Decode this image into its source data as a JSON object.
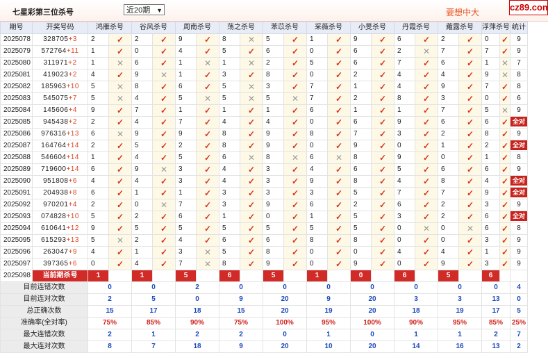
{
  "header": {
    "title": "七星彩第三位杀号",
    "range_selected": "近20期",
    "promo": "要想中大",
    "badge": "cz89.com"
  },
  "columns": [
    "期号",
    "开奖号码",
    "鸿雁杀号",
    "谷风杀号",
    "周南杀号",
    "荡之杀号",
    "苯苡杀号",
    "采薇杀号",
    "小旻杀号",
    "丹霞杀号",
    "蕹露杀号",
    "浮萍杀号",
    "统计"
  ],
  "rows": [
    {
      "period": "2025078",
      "draw": "328705",
      "diff": "+3",
      "kills": [
        "2",
        "2",
        "9",
        "8",
        "5",
        "1",
        "9",
        "6",
        "2",
        "0"
      ],
      "marks": [
        "v",
        "v",
        "v",
        "x",
        "v",
        "v",
        "v",
        "v",
        "v",
        "v"
      ],
      "count": "9"
    },
    {
      "period": "2025079",
      "draw": "572764",
      "diff": "+11",
      "kills": [
        "1",
        "0",
        "4",
        "5",
        "6",
        "0",
        "6",
        "2",
        "7",
        "7"
      ],
      "marks": [
        "v",
        "v",
        "v",
        "v",
        "v",
        "v",
        "v",
        "x",
        "v",
        "v"
      ],
      "count": "9"
    },
    {
      "period": "2025080",
      "draw": "311971",
      "diff": "+2",
      "kills": [
        "1",
        "6",
        "1",
        "1",
        "2",
        "5",
        "6",
        "7",
        "6",
        "1"
      ],
      "marks": [
        "x",
        "v",
        "x",
        "x",
        "v",
        "v",
        "v",
        "v",
        "v",
        "x"
      ],
      "count": "7"
    },
    {
      "period": "2025081",
      "draw": "419023",
      "diff": "+2",
      "kills": [
        "4",
        "9",
        "1",
        "3",
        "8",
        "0",
        "2",
        "4",
        "4",
        "9"
      ],
      "marks": [
        "v",
        "x",
        "v",
        "v",
        "v",
        "v",
        "v",
        "v",
        "v",
        "x"
      ],
      "count": "8"
    },
    {
      "period": "2025082",
      "draw": "185963",
      "diff": "+10",
      "kills": [
        "5",
        "8",
        "6",
        "5",
        "3",
        "7",
        "1",
        "4",
        "9",
        "7"
      ],
      "marks": [
        "x",
        "v",
        "v",
        "x",
        "v",
        "v",
        "v",
        "v",
        "v",
        "v"
      ],
      "count": "8"
    },
    {
      "period": "2025083",
      "draw": "545075",
      "diff": "+7",
      "kills": [
        "5",
        "4",
        "5",
        "5",
        "5",
        "7",
        "2",
        "8",
        "3",
        "0"
      ],
      "marks": [
        "x",
        "v",
        "x",
        "x",
        "x",
        "v",
        "v",
        "v",
        "v",
        "v"
      ],
      "count": "6"
    },
    {
      "period": "2025084",
      "draw": "145606",
      "diff": "+4",
      "kills": [
        "9",
        "7",
        "1",
        "1",
        "1",
        "6",
        "1",
        "1",
        "7",
        "5"
      ],
      "marks": [
        "v",
        "v",
        "v",
        "v",
        "v",
        "v",
        "v",
        "v",
        "v",
        "x"
      ],
      "count": "9"
    },
    {
      "period": "2025085",
      "draw": "945438",
      "diff": "+2",
      "kills": [
        "2",
        "4",
        "7",
        "4",
        "4",
        "0",
        "6",
        "9",
        "6",
        "6"
      ],
      "marks": [
        "v",
        "v",
        "v",
        "v",
        "v",
        "v",
        "v",
        "v",
        "v",
        "v"
      ],
      "count": "ALL"
    },
    {
      "period": "2025086",
      "draw": "976316",
      "diff": "+13",
      "kills": [
        "6",
        "9",
        "9",
        "8",
        "9",
        "8",
        "7",
        "3",
        "2",
        "8"
      ],
      "marks": [
        "x",
        "v",
        "v",
        "v",
        "v",
        "v",
        "v",
        "v",
        "v",
        "v"
      ],
      "count": "9"
    },
    {
      "period": "2025087",
      "draw": "164764",
      "diff": "+14",
      "kills": [
        "2",
        "5",
        "2",
        "8",
        "9",
        "0",
        "9",
        "0",
        "1",
        "2"
      ],
      "marks": [
        "v",
        "v",
        "v",
        "v",
        "v",
        "v",
        "v",
        "v",
        "v",
        "v"
      ],
      "count": "ALL"
    },
    {
      "period": "2025088",
      "draw": "546604",
      "diff": "+14",
      "kills": [
        "1",
        "4",
        "5",
        "6",
        "8",
        "6",
        "8",
        "9",
        "0",
        "1"
      ],
      "marks": [
        "v",
        "v",
        "v",
        "x",
        "x",
        "x",
        "v",
        "v",
        "v",
        "v"
      ],
      "count": "8"
    },
    {
      "period": "2025089",
      "draw": "719600",
      "diff": "+14",
      "kills": [
        "6",
        "9",
        "3",
        "4",
        "3",
        "4",
        "6",
        "5",
        "6",
        "6"
      ],
      "marks": [
        "v",
        "x",
        "v",
        "v",
        "v",
        "v",
        "v",
        "v",
        "v",
        "v"
      ],
      "count": "9"
    },
    {
      "period": "2025090",
      "draw": "951808",
      "diff": "+6",
      "kills": [
        "4",
        "4",
        "3",
        "4",
        "3",
        "9",
        "8",
        "4",
        "8",
        "4"
      ],
      "marks": [
        "v",
        "v",
        "v",
        "v",
        "v",
        "v",
        "v",
        "v",
        "v",
        "v"
      ],
      "count": "ALL"
    },
    {
      "period": "2025091",
      "draw": "204938",
      "diff": "+8",
      "kills": [
        "6",
        "1",
        "1",
        "3",
        "3",
        "3",
        "5",
        "7",
        "7",
        "9"
      ],
      "marks": [
        "v",
        "v",
        "v",
        "v",
        "v",
        "v",
        "v",
        "v",
        "v",
        "v"
      ],
      "count": "ALL"
    },
    {
      "period": "2025092",
      "draw": "970201",
      "diff": "+4",
      "kills": [
        "2",
        "0",
        "7",
        "3",
        "9",
        "6",
        "2",
        "6",
        "2",
        "3"
      ],
      "marks": [
        "v",
        "x",
        "v",
        "v",
        "v",
        "v",
        "v",
        "v",
        "v",
        "v"
      ],
      "count": "9"
    },
    {
      "period": "2025093",
      "draw": "074828",
      "diff": "+10",
      "kills": [
        "5",
        "2",
        "6",
        "1",
        "0",
        "1",
        "5",
        "3",
        "2",
        "6"
      ],
      "marks": [
        "v",
        "v",
        "v",
        "v",
        "v",
        "v",
        "v",
        "v",
        "v",
        "v"
      ],
      "count": "ALL"
    },
    {
      "period": "2025094",
      "draw": "610641",
      "diff": "+12",
      "kills": [
        "9",
        "5",
        "5",
        "5",
        "5",
        "5",
        "5",
        "0",
        "0",
        "6"
      ],
      "marks": [
        "v",
        "v",
        "v",
        "v",
        "v",
        "v",
        "v",
        "x",
        "x",
        "v"
      ],
      "count": "8"
    },
    {
      "period": "2025095",
      "draw": "615293",
      "diff": "+13",
      "kills": [
        "5",
        "2",
        "4",
        "6",
        "6",
        "8",
        "8",
        "0",
        "0",
        "3"
      ],
      "marks": [
        "x",
        "v",
        "v",
        "v",
        "v",
        "v",
        "v",
        "v",
        "v",
        "v"
      ],
      "count": "9"
    },
    {
      "period": "2025096",
      "draw": "263047",
      "diff": "+9",
      "kills": [
        "4",
        "1",
        "3",
        "5",
        "8",
        "0",
        "0",
        "4",
        "4",
        "1"
      ],
      "marks": [
        "v",
        "v",
        "x",
        "v",
        "v",
        "v",
        "v",
        "v",
        "v",
        "v"
      ],
      "count": "9"
    },
    {
      "period": "2025097",
      "draw": "397365",
      "diff": "+6",
      "kills": [
        "0",
        "4",
        "7",
        "8",
        "9",
        "0",
        "9",
        "0",
        "9",
        "3"
      ],
      "marks": [
        "v",
        "v",
        "x",
        "v",
        "v",
        "v",
        "v",
        "v",
        "v",
        "v"
      ],
      "count": "9"
    }
  ],
  "current": {
    "period": "2025098",
    "label": "当前期杀号",
    "kills": [
      "1",
      "1",
      "5",
      "6",
      "5",
      "1",
      "0",
      "6",
      "5",
      "6"
    ]
  },
  "stats": [
    {
      "label": "目前连错次数",
      "values": [
        "0",
        "0",
        "2",
        "0",
        "0",
        "0",
        "0",
        "0",
        "0",
        "0",
        "4"
      ]
    },
    {
      "label": "目前连对次数",
      "values": [
        "2",
        "5",
        "0",
        "9",
        "20",
        "9",
        "20",
        "3",
        "3",
        "13",
        "0"
      ]
    },
    {
      "label": "总正确次数",
      "values": [
        "15",
        "17",
        "18",
        "15",
        "20",
        "19",
        "20",
        "18",
        "19",
        "17",
        "5"
      ]
    },
    {
      "label": "准确率(全对率)",
      "values": [
        "75%",
        "85%",
        "90%",
        "75%",
        "100%",
        "95%",
        "100%",
        "90%",
        "95%",
        "85%",
        "25%"
      ]
    },
    {
      "label": "最大连错次数",
      "values": [
        "2",
        "1",
        "2",
        "2",
        "0",
        "1",
        "0",
        "1",
        "1",
        "2",
        "7"
      ]
    },
    {
      "label": "最大连对次数",
      "values": [
        "8",
        "7",
        "18",
        "9",
        "20",
        "10",
        "20",
        "14",
        "16",
        "13",
        "2"
      ]
    }
  ],
  "allok_label": "全对",
  "colors": {
    "accent": "#d12b28",
    "header_bg": "#e8ecf6",
    "mark_bg": "#fdf9e6",
    "stat_blue": "#1b49c0"
  }
}
